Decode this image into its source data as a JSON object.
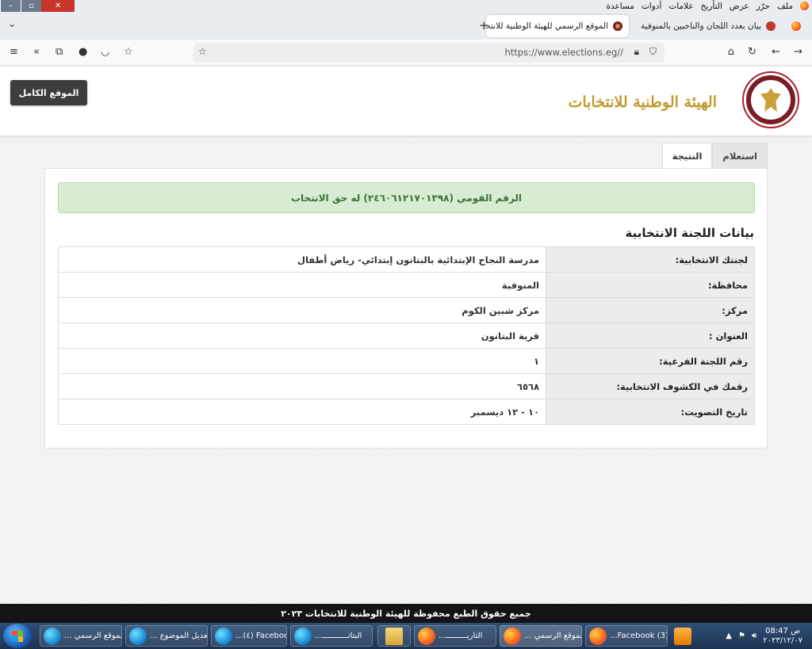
{
  "browser": {
    "menu_items": [
      "ملف",
      "حرّر",
      "عرض",
      "التأريخ",
      "علامات",
      "أدوات",
      "مساعدة"
    ],
    "tabs": [
      {
        "title": "بيان بعدد اللجان والناخبين بالمنوفية",
        "active": false
      },
      {
        "title": "الموقع الرسمي للهيئة الوطنية للانتخاب",
        "active": true
      }
    ],
    "url": "https://www.elections.eg//",
    "new_tab": "+",
    "close_glyph": "×"
  },
  "site": {
    "title": "الهيئة الوطنية للانتخابات",
    "full_site_button": "الموقع الكامل",
    "tabs": {
      "inquiry": "استعلام",
      "result": "النتيجة"
    },
    "alert": "الرقم القومي (٢٤٦٠٦١٢١٧٠١٣٩٨) له حق الانتخاب",
    "section_title": "بيانات اللجنة الانتخابية",
    "rows": [
      {
        "key": "لجنتك الانتخابية:",
        "value": "مدرسة النجاح الإبتدائية بالبتانون إبتدائي- رياض أطفال"
      },
      {
        "key": "محافظة:",
        "value": "المنوفية"
      },
      {
        "key": "مركز:",
        "value": "مركز شبين الكوم"
      },
      {
        "key": "العنوان :",
        "value": "قرية البتانون"
      },
      {
        "key": "رقم اللجنة الفرعية:",
        "value": "١"
      },
      {
        "key": "رقمك في الكشوف الانتخابية:",
        "value": "٦٥٦٨"
      },
      {
        "key": "تاريخ التصويت:",
        "value": "١٠ - ١٢ ديسمبر"
      }
    ],
    "footer": "جميع حقوق الطبع محفوظة للهيئة الوطنية للانتخابات ٢٠٢٣"
  },
  "taskbar": {
    "items": [
      {
        "label": "الموقع الرسمي ...",
        "icon": "edge"
      },
      {
        "label": "تعديل الموضوع ...",
        "icon": "edge"
      },
      {
        "label": "Facebook (٤)...",
        "icon": "edge"
      },
      {
        "label": "البتانـــــــــــ...",
        "icon": "edge"
      },
      {
        "label": "",
        "icon": "folder"
      },
      {
        "label": "التاريـــــــــ...",
        "icon": "firefox"
      },
      {
        "label": "الموقع الرسمي ...",
        "icon": "firefox"
      },
      {
        "label": "(3) Facebook...",
        "icon": "firefox"
      },
      {
        "label": "",
        "icon": "media"
      }
    ],
    "clock_ampm": "ص",
    "clock_time": "08:47",
    "clock_date": "٢٠٢٣/١٢/٠٧"
  }
}
